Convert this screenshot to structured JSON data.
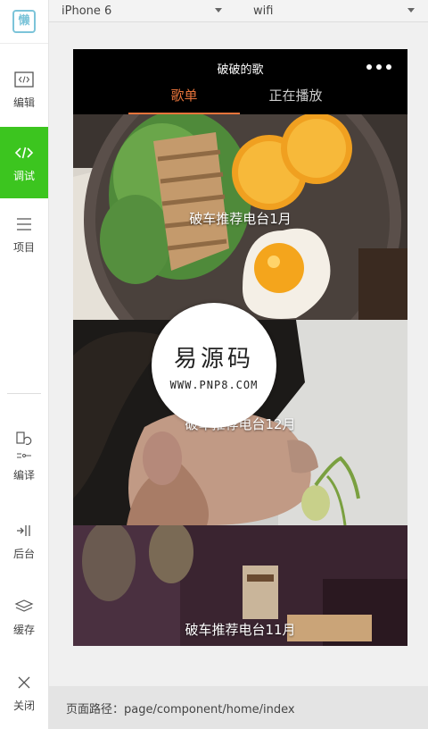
{
  "sidebar": {
    "logo_text": "懒",
    "items": [
      {
        "label": "编辑",
        "icon": "code-editor-icon"
      },
      {
        "label": "调试",
        "icon": "debug-code-icon",
        "active": true
      },
      {
        "label": "项目",
        "icon": "menu-lines-icon"
      },
      {
        "label": "编译",
        "icon": "compile-icon"
      },
      {
        "label": "后台",
        "icon": "background-icon"
      },
      {
        "label": "缓存",
        "icon": "layers-icon"
      },
      {
        "label": "关闭",
        "icon": "close-icon"
      }
    ]
  },
  "toolbar": {
    "device": "iPhone 6",
    "network": "wifi"
  },
  "phone": {
    "nav_title": "破破的歌",
    "more_icon": "more-dots-icon",
    "tabs": [
      {
        "label": "歌单",
        "active": true
      },
      {
        "label": "正在播放",
        "active": false
      }
    ],
    "cards": [
      {
        "label": "破车推荐电台1月"
      },
      {
        "label": "破车推荐电台12月"
      },
      {
        "label": "破车推荐电台11月"
      }
    ]
  },
  "watermark": {
    "title": "易源码",
    "url": "WWW.PNP8.COM"
  },
  "status": {
    "path_label": "页面路径：page/component/home/index"
  },
  "colors": {
    "accent_green": "#3cc51f",
    "tab_active": "#e8743b"
  }
}
